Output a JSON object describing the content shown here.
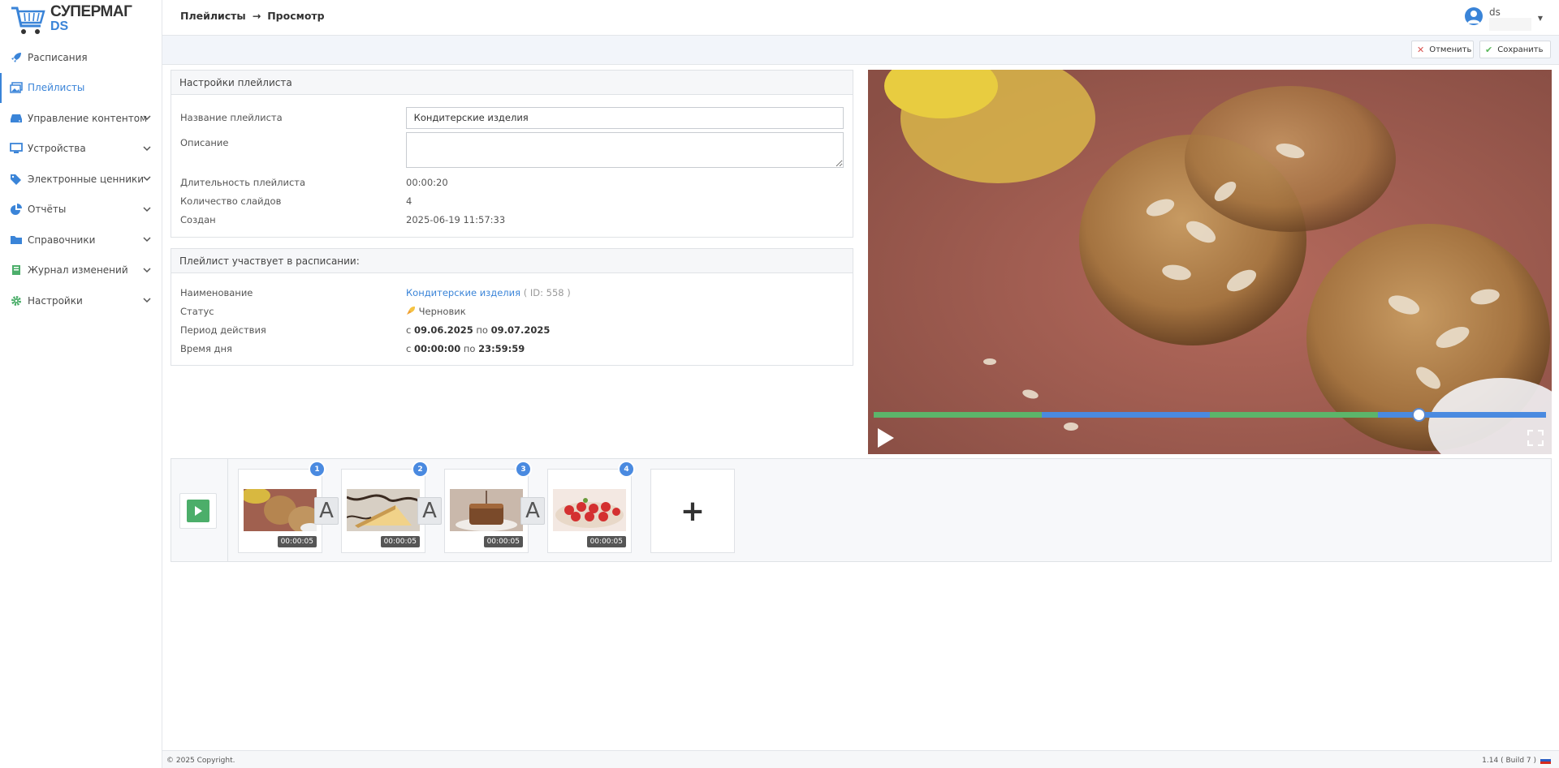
{
  "brand": {
    "line1": "СУПЕРМАГ",
    "line2": "DS"
  },
  "sidebar": {
    "items": [
      {
        "label": "Расписания",
        "icon": "rocket-icon"
      },
      {
        "label": "Плейлисты",
        "icon": "images-icon"
      },
      {
        "label": "Управление контентом",
        "icon": "hdd-icon"
      },
      {
        "label": "Устройства",
        "icon": "monitor-icon"
      },
      {
        "label": "Электронные ценники",
        "icon": "tags-icon"
      },
      {
        "label": "Отчёты",
        "icon": "pie-chart-icon"
      },
      {
        "label": "Справочники",
        "icon": "folder-icon"
      },
      {
        "label": "Журнал изменений",
        "icon": "book-icon"
      },
      {
        "label": "Настройки",
        "icon": "gear-icon"
      }
    ]
  },
  "header": {
    "crumb1": "Плейлисты",
    "crumb_sep": "→",
    "crumb2": "Просмотр",
    "user": "ds"
  },
  "toolbar": {
    "cancel_label": "Отменить",
    "save_label": "Сохранить"
  },
  "settings": {
    "title": "Настройки плейлиста",
    "name_label": "Название плейлиста",
    "name_value": "Кондитерские изделия",
    "desc_label": "Описание",
    "duration_label": "Длительность плейлиста",
    "duration_value": "00:00:20",
    "slides_label": "Количество слайдов",
    "slides_value": "4",
    "created_label": "Создан",
    "created_value": "2025-06-19 11:57:33"
  },
  "schedule": {
    "title": "Плейлист участвует в расписании:",
    "name_label": "Наименование",
    "name_link": "Кондитерские изделия",
    "name_id": "( ID: 558 )",
    "status_label": "Статус",
    "status_value": "Черновик",
    "period_label": "Период действия",
    "period_from_word": "с",
    "period_from": "09.06.2025",
    "period_to_word": "по",
    "period_to": "09.07.2025",
    "time_label": "Время дня",
    "time_from_word": "с",
    "time_from": "00:00:00",
    "time_to_word": "по",
    "time_to": "23:59:59"
  },
  "player": {
    "progress_fraction": 0.81,
    "segments": [
      "#5cb56a",
      "#4a8ae0",
      "#5cb56a",
      "#4a8ae0"
    ]
  },
  "slides": [
    {
      "num": "1",
      "duration": "00:00:05"
    },
    {
      "num": "2",
      "duration": "00:00:05"
    },
    {
      "num": "3",
      "duration": "00:00:05"
    },
    {
      "num": "4",
      "duration": "00:00:05"
    }
  ],
  "transition_label": "A",
  "add_label": "+",
  "footer": {
    "copyright": "© 2025 Copyright.",
    "build": "1.14 ( Build 7 )"
  }
}
